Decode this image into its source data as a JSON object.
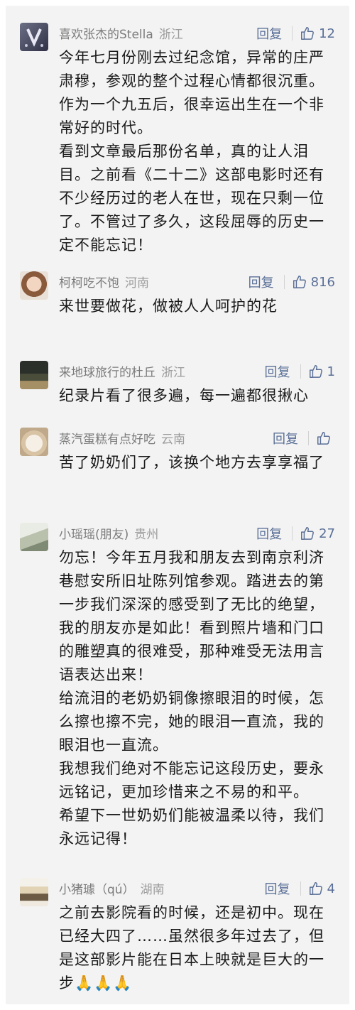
{
  "comments": [
    {
      "nickname": "喜欢张杰的Stella",
      "region": "浙江",
      "reply_label": "回复",
      "likes": "12",
      "text": "今年七月份刚去过纪念馆，异常的庄严肃穆，参观的整个过程心情都很沉重。作为一个九五后，很幸运出生在一个非常好的时代。\n看到文章最后那份名单，真的让人泪目。之前看《二十二》这部电影时还有不少经历过的老人在世，现在只剩一位了。不管过了多久，这段屈辱的历史一定不能忘记！"
    },
    {
      "nickname": "柯柯吃不饱",
      "region": "河南",
      "reply_label": "回复",
      "likes": "816",
      "text": "来世要做花，做被人人呵护的花"
    },
    {
      "nickname": "来地球旅行的杜丘",
      "region": "浙江",
      "reply_label": "回复",
      "likes": "1",
      "text": "纪录片看了很多遍，每一遍都很揪心"
    },
    {
      "nickname": "蒸汽蛋糕有点好吃",
      "region": "云南",
      "reply_label": "回复",
      "likes": "",
      "text": "苦了奶奶们了，该换个地方去享享福了"
    },
    {
      "nickname": "小瑶瑶(朋友)",
      "region": "贵州",
      "reply_label": "回复",
      "likes": "27",
      "text": "勿忘！今年五月我和朋友去到南京利济巷慰安所旧址陈列馆参观。踏进去的第一步我们深深的感受到了无比的绝望，我的朋友亦是如此！看到照片墙和门口的雕塑真的很难受，那种难受无法用言语表达出来！\n给流泪的老奶奶铜像擦眼泪的时候，怎么擦也擦不完，她的眼泪一直流，我的眼泪也一直流。\n我想我们绝对不能忘记这段历史，要永远铭记，更加珍惜来之不易的和平。\n希望下一世奶奶们能被温柔以待，我们永远记得！"
    },
    {
      "nickname": "小猪璩（qú）",
      "region": "湖南",
      "reply_label": "回复",
      "likes": "4",
      "text": "之前去影院看的时候，还是初中。现在已经大四了……虽然很多年过去了，但是这部影片能在日本上映就是巨大的一步🙏🙏🙏"
    }
  ]
}
